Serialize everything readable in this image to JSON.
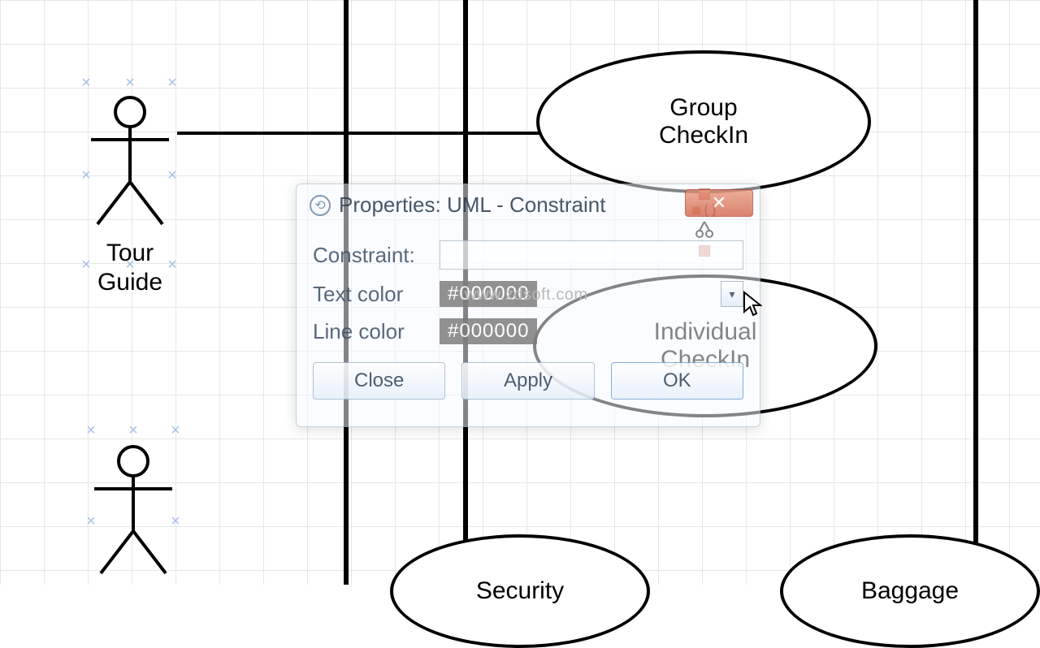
{
  "actors": {
    "tour_guide": {
      "label": "Tour\nGuide"
    },
    "second_actor": {
      "label": ""
    }
  },
  "usecases": {
    "group_checkin": {
      "label": "Group\nCheckIn"
    },
    "individual_checkin": {
      "label": "Individual\nCheckIn"
    },
    "security": {
      "label": "Security"
    },
    "baggage": {
      "label": "Baggage"
    }
  },
  "constraint_node": {
    "braces": "{ }"
  },
  "dialog": {
    "title": "Properties: UML - Constraint",
    "fields": {
      "constraint_label": "Constraint:",
      "constraint_value": "",
      "text_color_label": "Text color",
      "text_color_value": "#000000",
      "line_color_label": "Line color",
      "line_color_value": "#000000"
    },
    "buttons": {
      "close": "Close",
      "apply": "Apply",
      "ok": "OK"
    }
  },
  "watermark": "www.zdsoft.com",
  "chart_data": {
    "type": "uml-use-case",
    "actors": [
      {
        "name": "Tour Guide"
      },
      {
        "name": "(unnamed actor)"
      }
    ],
    "use_cases": [
      "Group CheckIn",
      "Individual CheckIn",
      "Security",
      "Baggage"
    ],
    "associations": [
      {
        "from": "Tour Guide",
        "to": "Group CheckIn"
      }
    ],
    "constraints": [
      {
        "between": [
          "Group CheckIn",
          "Individual CheckIn"
        ],
        "text": ""
      }
    ],
    "open_dialog": "Properties: UML - Constraint"
  }
}
